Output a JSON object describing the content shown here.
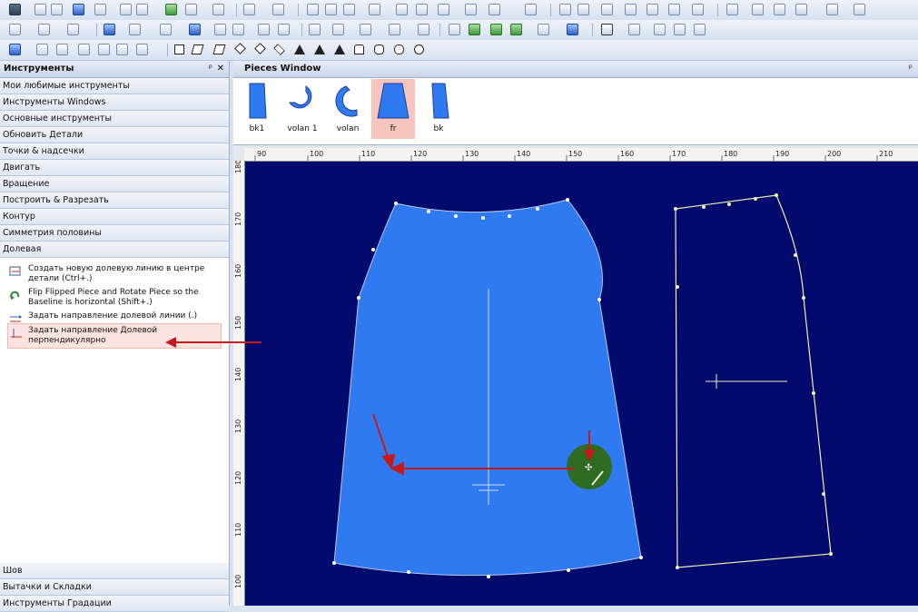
{
  "app": {
    "accent": "#2d62c9",
    "canvas_bg": "#020a6e",
    "piece_fill": "#2f7af0",
    "arrow_color": "#c51a1a"
  },
  "toolbars": {
    "row1_icons": [
      "pointer-icon",
      "new-icon",
      "open-icon",
      "save-icon",
      "print-icon",
      "plot-icon",
      "excel-icon",
      "tools-icon",
      "zoom-icon",
      "undo-icon",
      "redo-icon",
      "cut-icon",
      "copy-icon",
      "paste-icon",
      "clipboard-icon",
      "mark-icon",
      "piece-icon",
      "add-icon",
      "flip-icon",
      "rotate-icon"
    ],
    "row2_icons": [
      "point-icon",
      "notch-icon",
      "measure-icon",
      "pin-icon",
      "target-icon",
      "grade-icon",
      "text-icon",
      "rotate-icon",
      "lasso-icon",
      "curve-icon",
      "cut-icon",
      "pen-icon",
      "line-icon",
      "add-icon",
      "group-icon",
      "delete-icon",
      "arc-icon",
      "flip-icon",
      "grade-icon",
      "filter-icon",
      "grain-icon",
      "mirror-icon",
      "table-icon",
      "doc-icon"
    ],
    "row3_shapes": [
      "square-shape-icon",
      "parallelogram-shape-icon",
      "trapezoid-shape-icon",
      "diamond-shape-icon",
      "kite-shape-icon",
      "rhombus-shape-icon",
      "triangle-shape-icon",
      "right-triangle-shape-icon",
      "pentagon-shape-icon",
      "hexagon-shape-icon",
      "octagon-shape-icon",
      "circle-shape-icon"
    ]
  },
  "left_panel": {
    "title": "Инструменты",
    "pin": "ᵖ",
    "close": "✕",
    "categories": [
      "Мои любимые инструменты",
      "Инструменты Windows",
      "Основные инструменты",
      "Обновить Детали",
      "Точки & надсечки",
      "Двигать",
      "Вращение",
      "Построить & Разрезать",
      "Контур",
      "Симметрия половины",
      "Долевая"
    ],
    "tools": [
      {
        "label": "Создать новую долевую линию в центре детали (Ctrl+.)",
        "icon": "create-grain-icon"
      },
      {
        "label": "Flip Flipped Piece and Rotate Piece so the Baseline is horizontal (Shift+.)",
        "icon": "flip-rotate-icon"
      },
      {
        "label": "Задать направление долевой линии (.)",
        "icon": "grain-direction-icon"
      },
      {
        "label": "Задать направление Долевой перпендикулярно",
        "icon": "grain-perpendicular-icon"
      }
    ],
    "bottom_categories": [
      "Шов",
      "Вытачки и Складки",
      "Инструменты Градации"
    ]
  },
  "pieces_window": {
    "title": "Pieces Window",
    "pin": "ᵖ",
    "pieces": [
      {
        "name": "bk1",
        "selected": false
      },
      {
        "name": "volan 1",
        "selected": false
      },
      {
        "name": "volan",
        "selected": false
      },
      {
        "name": "fr",
        "selected": true
      },
      {
        "name": "bk",
        "selected": false
      }
    ]
  },
  "rulers": {
    "top": [
      "90",
      "100",
      "110",
      "120",
      "130",
      "140",
      "150",
      "160",
      "170",
      "180",
      "190",
      "200",
      "210"
    ],
    "left": [
      "180",
      "170",
      "160",
      "150",
      "140",
      "130",
      "120",
      "110",
      "100"
    ]
  }
}
